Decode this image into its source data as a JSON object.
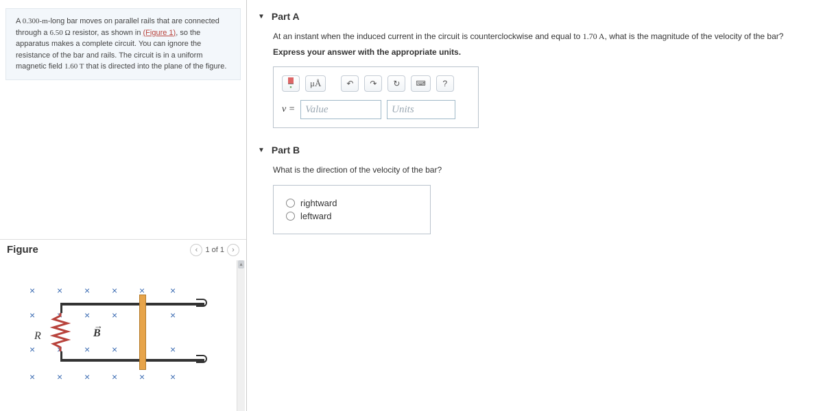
{
  "problem": {
    "len": "0.300-m",
    "res": "6.50 Ω",
    "fig_link": "(Figure 1)",
    "field": "1.60 T",
    "text_a": "A ",
    "text_b": "-long bar moves on parallel rails that are connected through a ",
    "text_c": " resistor, as shown in ",
    "text_d": ", so the apparatus makes a complete circuit. You can ignore the resistance of the bar and rails. The circuit is in a uniform magnetic field ",
    "text_e": " that is directed into the plane of the figure."
  },
  "figure": {
    "title": "Figure",
    "pager": "1 of 1",
    "r_label": "R",
    "b_label": "B"
  },
  "partA": {
    "title": "Part A",
    "prompt_a": "At an instant when the induced current in the circuit is counterclockwise and equal to ",
    "current": "1.70 A",
    "prompt_b": ", what is the magnitude of the velocity of the bar?",
    "sub": "Express your answer with the appropriate units.",
    "mu": "μÅ",
    "q": "?",
    "var": "v =",
    "value_ph": "Value",
    "units_ph": "Units"
  },
  "partB": {
    "title": "Part B",
    "prompt": "What is the direction of the velocity of the bar?",
    "opts": [
      "rightward",
      "leftward"
    ]
  }
}
